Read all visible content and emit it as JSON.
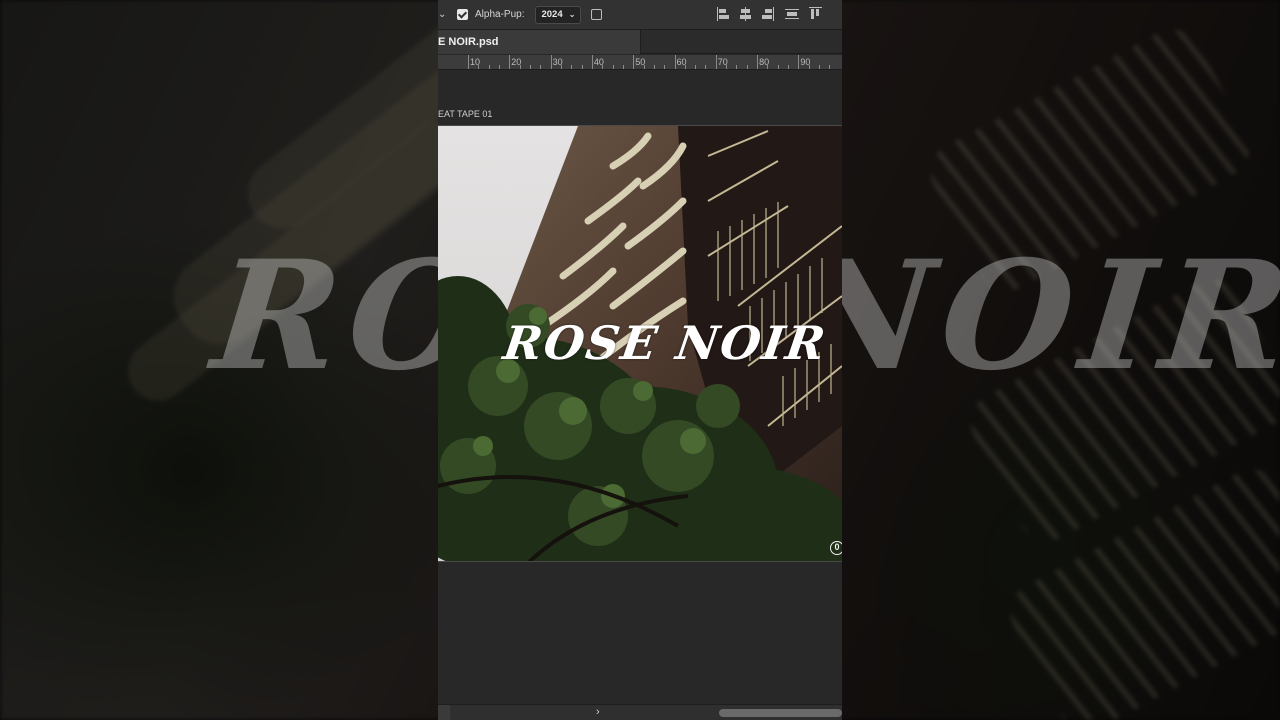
{
  "options_bar": {
    "auto_select_checked": true,
    "label": "Alpha-Pup:",
    "dropdown_value": "2024",
    "extra_checkbox_checked": false,
    "align_icons": [
      "align-left-edges-icon",
      "align-horizontal-centers-icon",
      "align-right-edges-icon",
      "distribute-vertical-icon",
      "align-top-edges-icon"
    ]
  },
  "document_tab": {
    "title": "E NOIR.psd"
  },
  "ruler": {
    "ticks": [
      "10",
      "20",
      "30",
      "40",
      "50",
      "60",
      "70",
      "80",
      "90"
    ]
  },
  "artboard": {
    "label": "EAT TAPE 01",
    "title_text": "ROSE NOIR",
    "corner_icon": "0"
  },
  "background": {
    "title_text": "ROSE NOIR"
  },
  "scrollbar": {
    "arrow": "›"
  },
  "colors": {
    "app_bg": "#282828",
    "options_bar_bg": "#323232",
    "tab_active_bg": "#3a3a3a",
    "ruler_bg": "#3c3c3c",
    "title_text": "#ffffff"
  }
}
